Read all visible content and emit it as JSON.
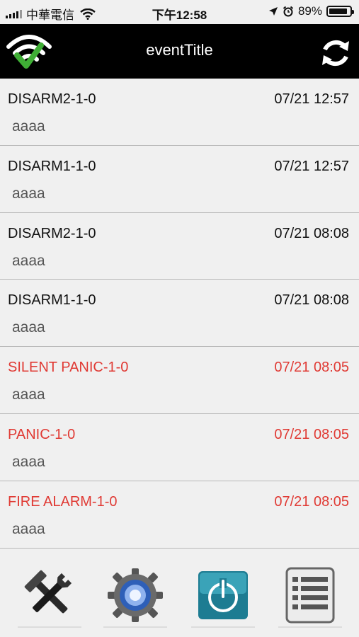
{
  "status": {
    "carrier": "中華電信",
    "time": "下午12:58",
    "battery": "89%",
    "battery_level": 0.89
  },
  "nav": {
    "title": "eventTitle"
  },
  "events": [
    {
      "title": "DISARM2-1-0",
      "time": "07/21 12:57",
      "message": "aaaa",
      "alarm": false
    },
    {
      "title": "DISARM1-1-0",
      "time": "07/21 12:57",
      "message": "aaaa",
      "alarm": false
    },
    {
      "title": "DISARM2-1-0",
      "time": "07/21 08:08",
      "message": "aaaa",
      "alarm": false
    },
    {
      "title": "DISARM1-1-0",
      "time": "07/21 08:08",
      "message": "aaaa",
      "alarm": false
    },
    {
      "title": "SILENT PANIC-1-0",
      "time": "07/21 08:05",
      "message": "aaaa",
      "alarm": true
    },
    {
      "title": "PANIC-1-0",
      "time": "07/21 08:05",
      "message": "aaaa",
      "alarm": true
    },
    {
      "title": "FIRE ALARM-1-0",
      "time": "07/21 08:05",
      "message": "aaaa",
      "alarm": true
    }
  ],
  "tabs": [
    {
      "icon": "tools-icon"
    },
    {
      "icon": "settings-gear-icon"
    },
    {
      "icon": "power-icon"
    },
    {
      "icon": "list-icon"
    }
  ],
  "colors": {
    "alarm": "#e03a34",
    "nav_bg": "#000000",
    "wifi_check": "#3fae35"
  }
}
